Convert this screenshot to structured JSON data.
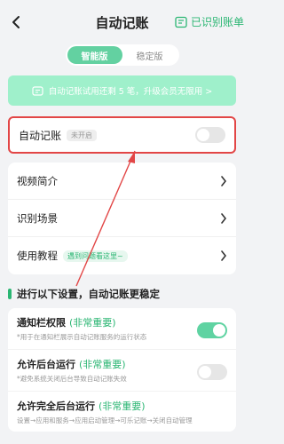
{
  "header": {
    "title": "自动记账",
    "right_label": "已识别账单"
  },
  "tabs": [
    {
      "label": "智能版",
      "active": true
    },
    {
      "label": "稳定版",
      "active": false
    }
  ],
  "trial": {
    "text": "自动记账试用还剩 5 笔，升级会员无限用 >"
  },
  "auto_record": {
    "label": "自动记账",
    "badge": "未开启",
    "enabled": false
  },
  "menu": [
    {
      "label": "视频简介",
      "pill": null
    },
    {
      "label": "识别场景",
      "pill": null
    },
    {
      "label": "使用教程",
      "pill": "遇到问题看这里~"
    }
  ],
  "section_title": "进行以下设置，自动记账更稳定",
  "settings": [
    {
      "title": "通知栏权限",
      "important": "(非常重要)",
      "sub": "*用于在通知栏展示自动记账服务的运行状态",
      "enabled": true
    },
    {
      "title": "允许后台运行",
      "important": "(非常重要)",
      "sub": "*避免系统关闭后台导致自动记账失效",
      "enabled": false
    },
    {
      "title": "允许完全后台运行",
      "important": "(非常重要)",
      "sub": "设置→应用和服务→应用启动管理→可乐记账→关闭自动管理",
      "enabled": null
    }
  ],
  "colors": {
    "accent": "#2bb673",
    "highlight_border": "#e24646"
  }
}
